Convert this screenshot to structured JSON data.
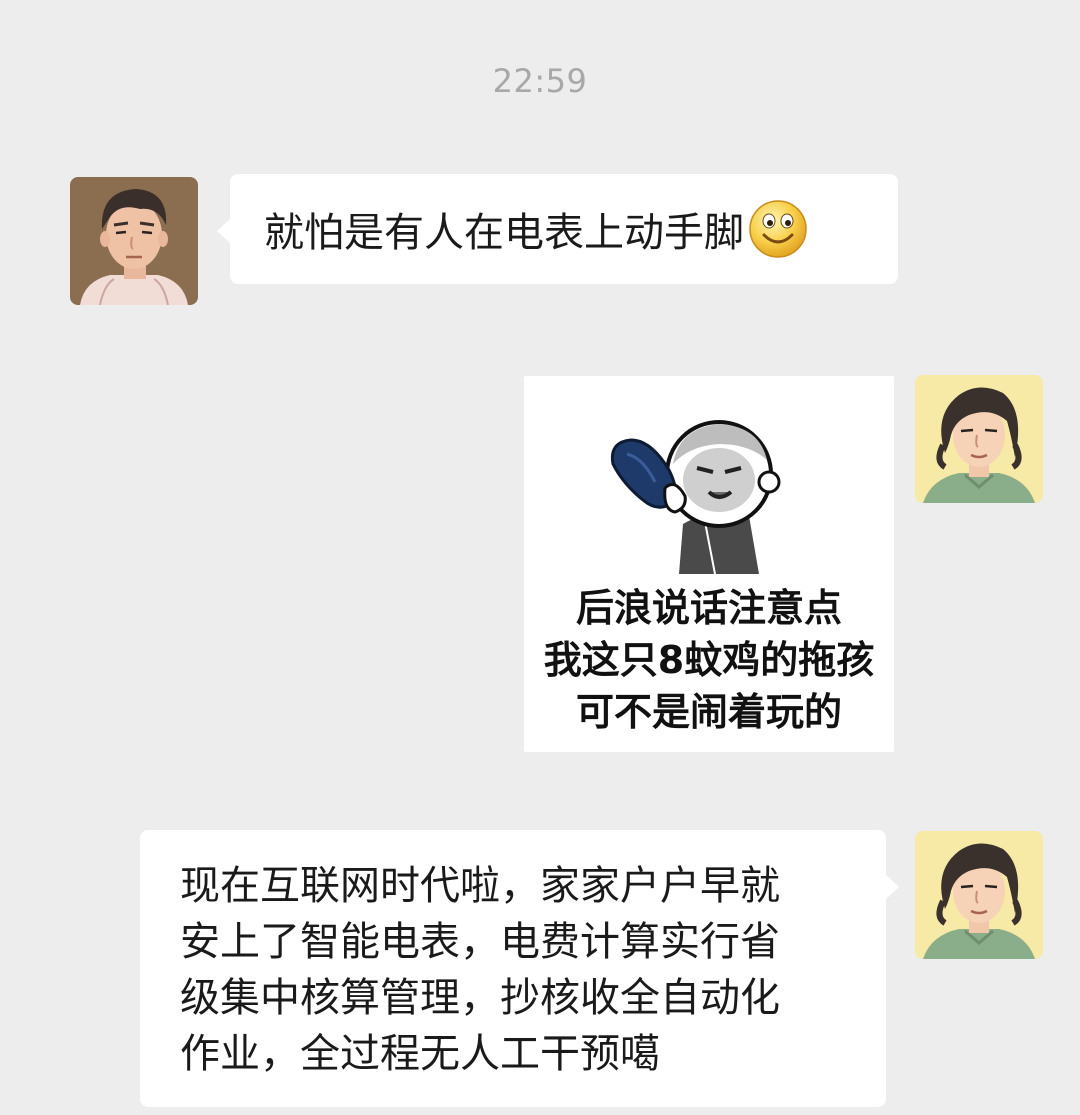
{
  "chat": {
    "timestamp": "22:59",
    "messages": [
      {
        "sender": "left",
        "type": "text",
        "text": "就怕是有人在电表上动手脚",
        "emoji": "smiley-emoji"
      },
      {
        "sender": "right",
        "type": "sticker",
        "caption_lines": [
          "后浪说话注意点",
          "我这只8蚊鸡的拖孩",
          "可不是闹着玩的"
        ]
      },
      {
        "sender": "right",
        "type": "text",
        "lines": [
          "现在互联网时代啦，家家户户早就",
          "安上了智能电表，电费计算实行省",
          "级集中核算管理，抄核收全自动化",
          "作业，全过程无人工干预噶"
        ]
      }
    ]
  },
  "colors": {
    "background": "#ededed",
    "bubble": "#ffffff",
    "timestamp": "#a8a8a8",
    "left_avatar_bg": "#8a6e4f",
    "right_avatar_bg": "#f7e9a6"
  }
}
